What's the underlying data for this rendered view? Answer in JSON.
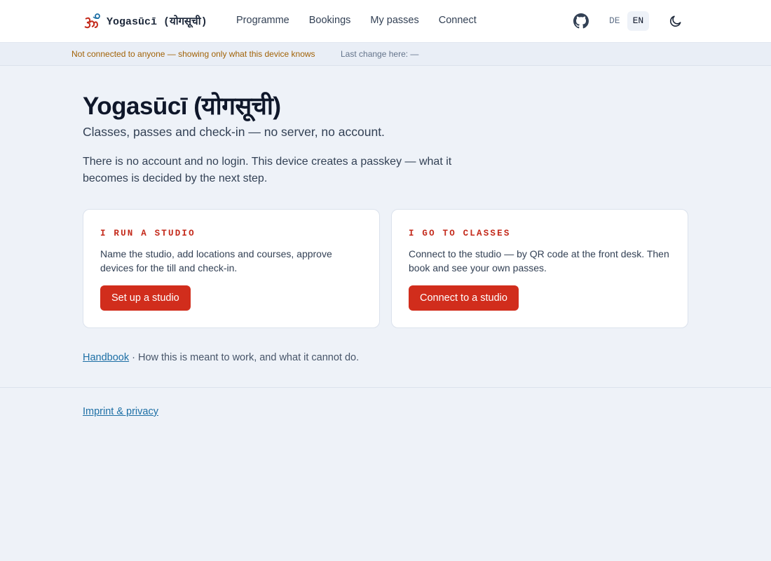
{
  "header": {
    "brand_name": "Yogasūcī (योगसूची)",
    "nav": [
      "Programme",
      "Bookings",
      "My passes",
      "Connect"
    ],
    "languages": [
      "DE",
      "EN"
    ],
    "active_language": "EN"
  },
  "status": {
    "connection": "Not connected to anyone — showing only what this device knows",
    "last_change": "Last change here: —"
  },
  "main": {
    "title": "Yogasūcī (योगसूची)",
    "subtitle": "Classes, passes and check-in — no server, no account.",
    "intro": "There is no account and no login. This device creates a passkey — what it becomes is decided by the next step.",
    "cards": [
      {
        "kicker": "I RUN A STUDIO",
        "text": "Name the studio, add locations and courses, approve devices for the till and check-in.",
        "button": "Set up a studio"
      },
      {
        "kicker": "I GO TO CLASSES",
        "text": "Connect to the studio — by QR code at the front desk. Then book and see your own passes.",
        "button": "Connect to a studio"
      }
    ],
    "handbook_link": "Handbook",
    "handbook_text": " · How this is meant to work, and what it cannot do."
  },
  "footer": {
    "imprint_link": "Imprint & privacy"
  },
  "colors": {
    "accent": "#d12d1c",
    "kicker": "#c42a1b",
    "warning_text": "#a16207",
    "link": "#1d6fa5",
    "background": "#eef2f8"
  },
  "icons": {
    "brand": "om-icon",
    "repo": "github-icon",
    "theme": "moon-icon"
  }
}
